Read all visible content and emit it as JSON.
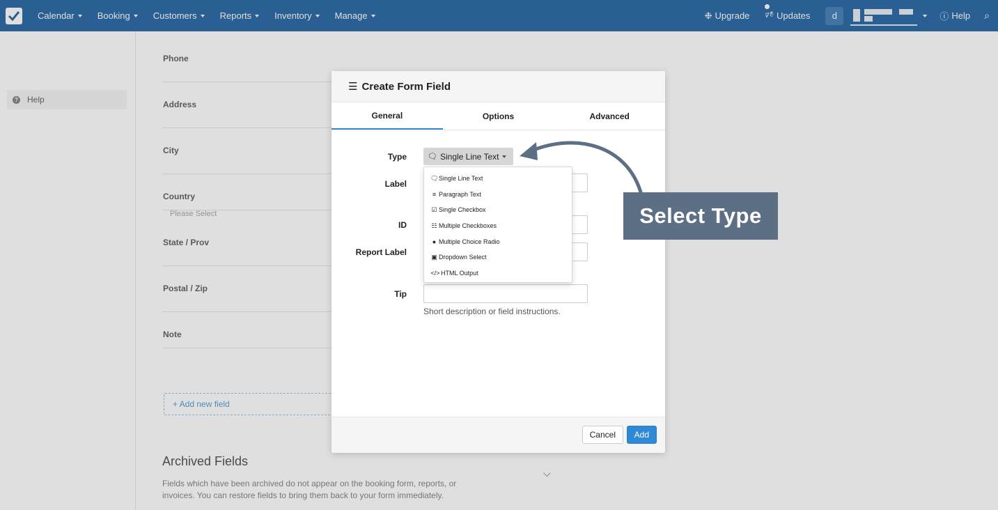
{
  "navbar": {
    "items": [
      "Calendar",
      "Booking",
      "Customers",
      "Reports",
      "Inventory",
      "Manage"
    ],
    "upgrade": "Upgrade",
    "updates": "Updates",
    "avatar_initial": "d",
    "help": "Help"
  },
  "sidebar": {
    "help": "Help"
  },
  "background_form": {
    "fields": [
      "Phone",
      "Address",
      "City",
      "Country",
      "State / Prov",
      "Postal / Zip",
      "Note"
    ],
    "country_placeholder": "Please Select",
    "add_new_field": "+ Add new field",
    "archived_title": "Archived Fields",
    "archived_description": "Fields which have been archived do not appear on the booking form, reports, or invoices. You can restore fields to bring them back to your form immediately."
  },
  "modal": {
    "title": "Create Form Field",
    "tabs": [
      "General",
      "Options",
      "Advanced"
    ],
    "active_tab": "General",
    "labels": {
      "type": "Type",
      "label": "Label",
      "id": "ID",
      "report_label": "Report Label",
      "tip": "Tip"
    },
    "type_selected": "Single Line Text",
    "type_options": [
      "Single Line Text",
      "Paragraph Text",
      "Single Checkbox",
      "Multiple Checkboxes",
      "Multiple Choice Radio",
      "Dropdown Select",
      "HTML Output"
    ],
    "tip_help": "Short description or field instructions.",
    "cancel": "Cancel",
    "add": "Add"
  },
  "callout": {
    "text": "Select Type"
  },
  "colors": {
    "navbar": "#2f6da7",
    "primary": "#2f89d6",
    "callout": "#5c6f84"
  }
}
